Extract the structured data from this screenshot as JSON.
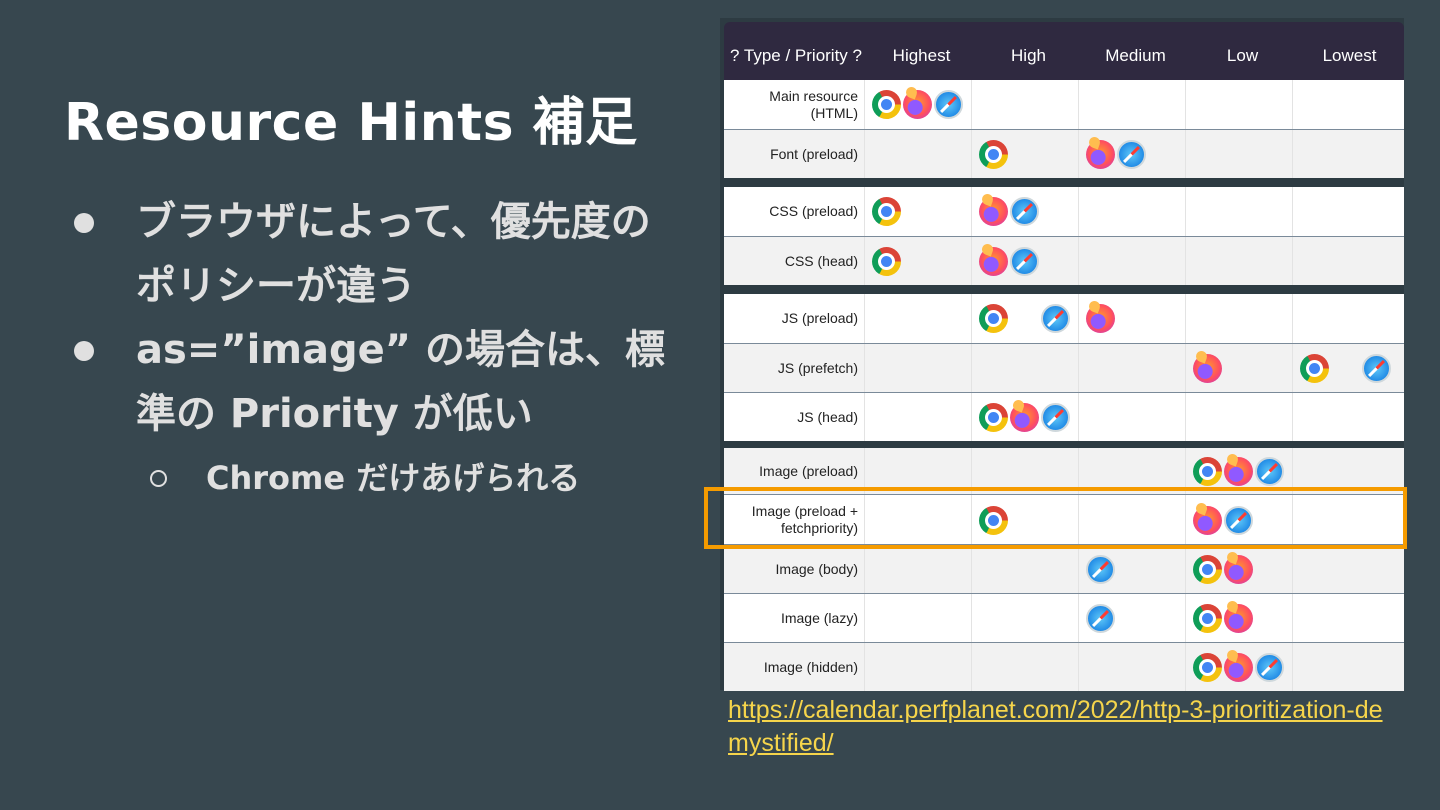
{
  "slide": {
    "title": "Resource Hints 補足",
    "bullets": [
      {
        "text": "ブラウザによって、優先度のポリシーが違う"
      },
      {
        "text": "as=”image” の場合は、標準の Priority が低い"
      }
    ],
    "sub_bullets": [
      {
        "text": "Chrome だけあげられる"
      }
    ]
  },
  "table": {
    "headers": [
      "? Type / Priority ?",
      "Highest",
      "High",
      "Medium",
      "Low",
      "Lowest"
    ],
    "rows": [
      {
        "label": "Main resource (HTML)",
        "cells": {
          "Highest": [
            "chrome",
            "firefox",
            "safari"
          ]
        }
      },
      {
        "label": "Font (preload)",
        "cells": {
          "High": [
            "chrome"
          ],
          "Medium": [
            "firefox",
            "safari"
          ]
        }
      },
      {
        "label": "CSS (preload)",
        "cells": {
          "Highest": [
            "chrome"
          ],
          "High": [
            "firefox",
            "safari"
          ]
        }
      },
      {
        "label": "CSS (head)",
        "cells": {
          "Highest": [
            "chrome"
          ],
          "High": [
            "firefox",
            "safari"
          ]
        }
      },
      {
        "label": "JS (preload)",
        "cells": {
          "High": [
            "chrome",
            "safari"
          ],
          "Medium": [
            "firefox"
          ]
        }
      },
      {
        "label": "JS (prefetch)",
        "cells": {
          "Low": [
            "firefox"
          ],
          "Lowest": [
            "chrome",
            "safari"
          ]
        }
      },
      {
        "label": "JS (head)",
        "cells": {
          "High": [
            "chrome",
            "firefox",
            "safari"
          ]
        }
      },
      {
        "label": "Image (preload)",
        "cells": {
          "Low": [
            "chrome",
            "firefox",
            "safari"
          ]
        }
      },
      {
        "label": "Image (preload + fetchpriority)",
        "cells": {
          "High": [
            "chrome"
          ],
          "Low": [
            "firefox",
            "safari"
          ]
        }
      },
      {
        "label": "Image (body)",
        "cells": {
          "Medium": [
            "safari"
          ],
          "Low": [
            "chrome",
            "firefox"
          ]
        }
      },
      {
        "label": "Image (lazy)",
        "cells": {
          "Medium": [
            "safari"
          ],
          "Low": [
            "chrome",
            "firefox"
          ]
        }
      },
      {
        "label": "Image (hidden)",
        "cells": {
          "Low": [
            "chrome",
            "firefox",
            "safari"
          ]
        }
      }
    ],
    "highlighted_row": "Image (preload + fetchpriority)",
    "highlight_color": "#f59b00",
    "icon_names": {
      "chrome": "chrome-icon",
      "firefox": "firefox-icon",
      "safari": "safari-icon"
    }
  },
  "source": {
    "url": "https://calendar.perfplanet.com/2022/http-3-prioritization-demystified/"
  },
  "colors": {
    "background": "#37474f",
    "header_bg": "#2f2940",
    "link": "#f6d54b"
  }
}
